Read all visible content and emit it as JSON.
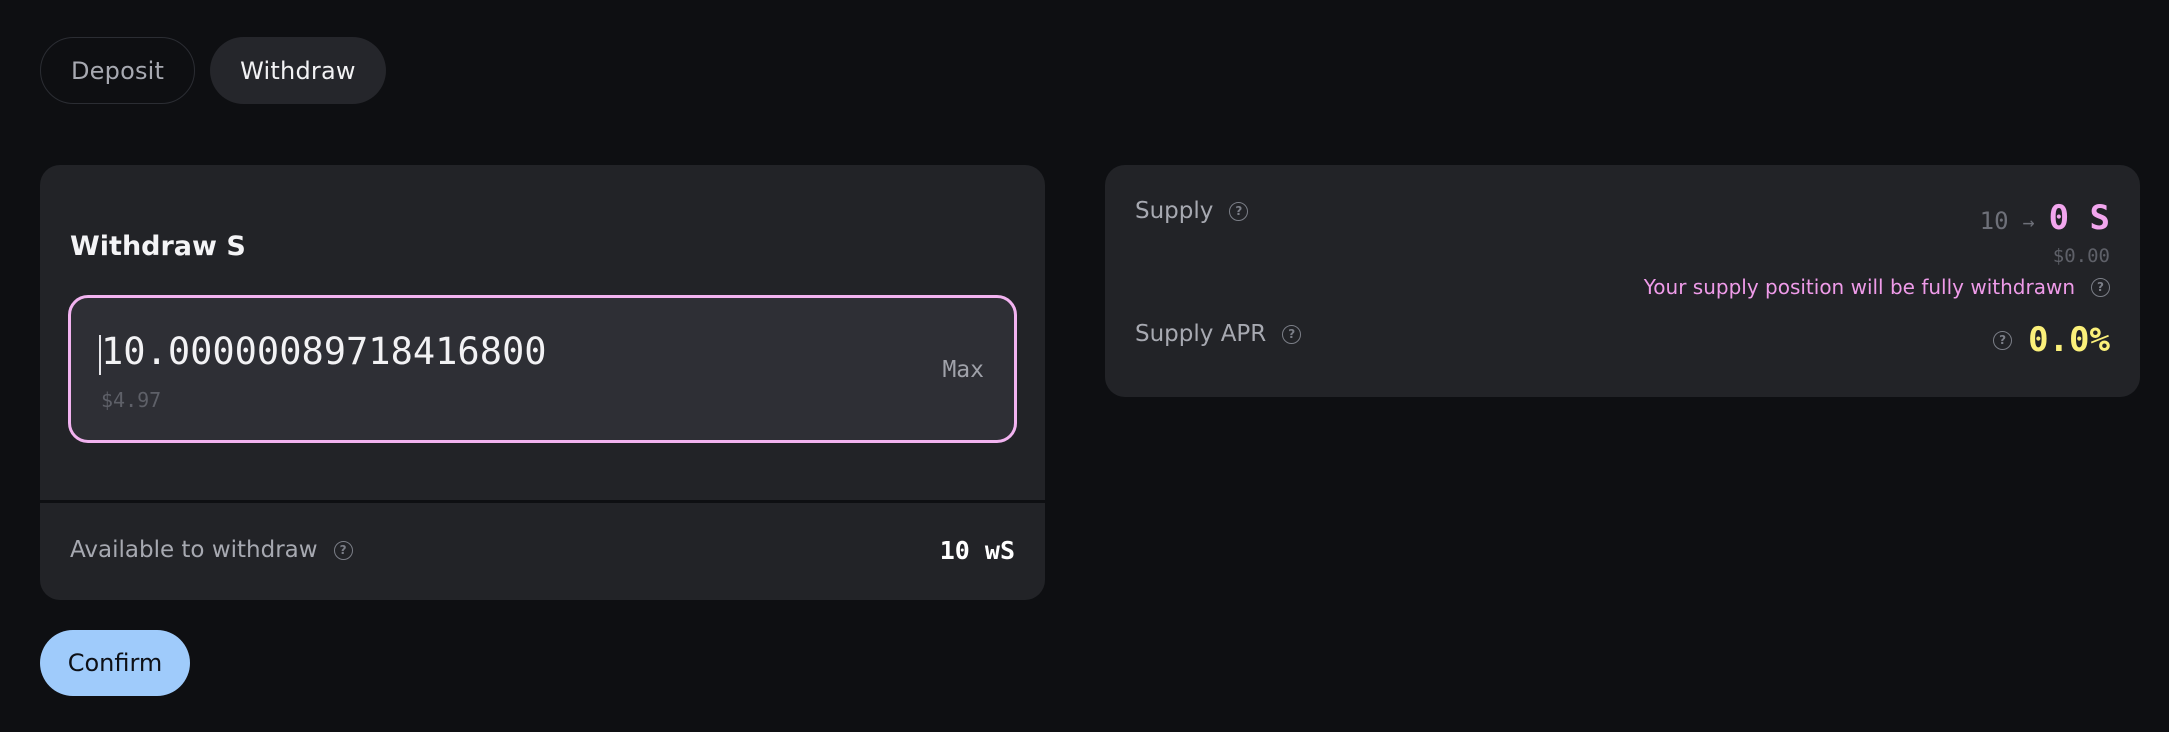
{
  "tabs": [
    {
      "label": "Deposit",
      "active": false
    },
    {
      "label": "Withdraw",
      "active": true
    }
  ],
  "withdraw_card": {
    "title": "Withdraw S",
    "amount_value": "10.000000897184168004",
    "amount_usd": "$4.97",
    "max_label": "Max",
    "available_label": "Available to withdraw",
    "available_value": "10 wS"
  },
  "summary_card": {
    "supply_label": "Supply",
    "supply_from": "10",
    "supply_arrow": "→",
    "supply_to": "0 S",
    "supply_usd": "$0.00",
    "notice": "Your supply position will be fully withdrawn",
    "apr_label": "Supply APR",
    "apr_value": "0.0%"
  },
  "confirm_label": "Confirm",
  "help_icon_glyph": "?",
  "colors": {
    "background": "#0e0f12",
    "card": "#222327",
    "accent_pink": "#f2a6ee",
    "accent_yellow": "#fbf07a",
    "confirm_blue": "#9fcbfb"
  }
}
